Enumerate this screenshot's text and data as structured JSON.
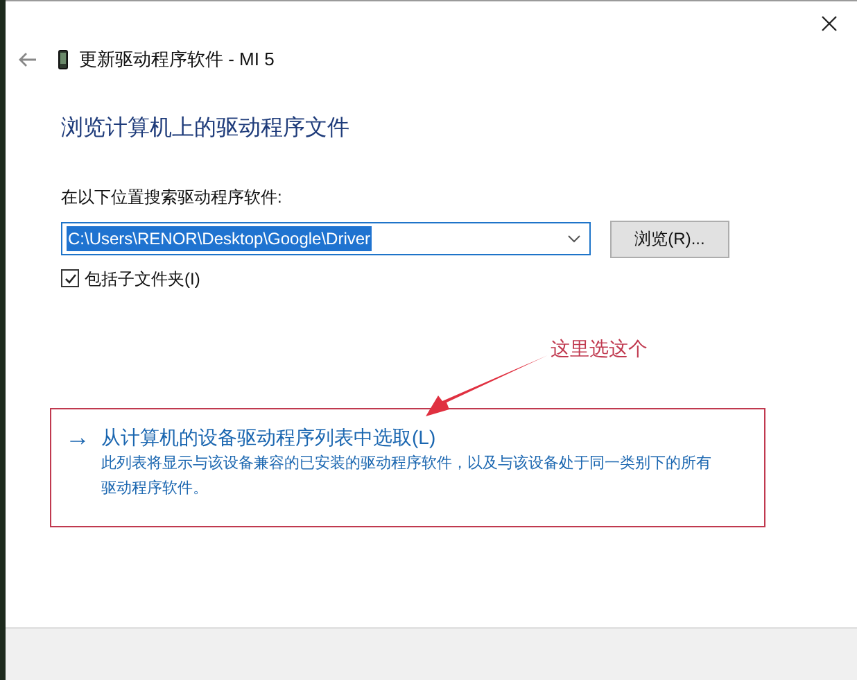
{
  "window": {
    "title": "更新驱动程序软件 - MI 5"
  },
  "heading": "浏览计算机上的驱动程序文件",
  "search_location": {
    "label": "在以下位置搜索驱动程序软件:",
    "value": "C:\\Users\\RENOR\\Desktop\\Google\\Driver",
    "browse_button": "浏览(R)..."
  },
  "include_subfolders": {
    "label": "包括子文件夹(I)",
    "checked": true
  },
  "annotation": {
    "text": "这里选这个"
  },
  "option": {
    "arrow": "→",
    "title": "从计算机的设备驱动程序列表中选取(L)",
    "description": "此列表将显示与该设备兼容的已安装的驱动程序软件，以及与该设备处于同一类别下的所有驱动程序软件。"
  }
}
